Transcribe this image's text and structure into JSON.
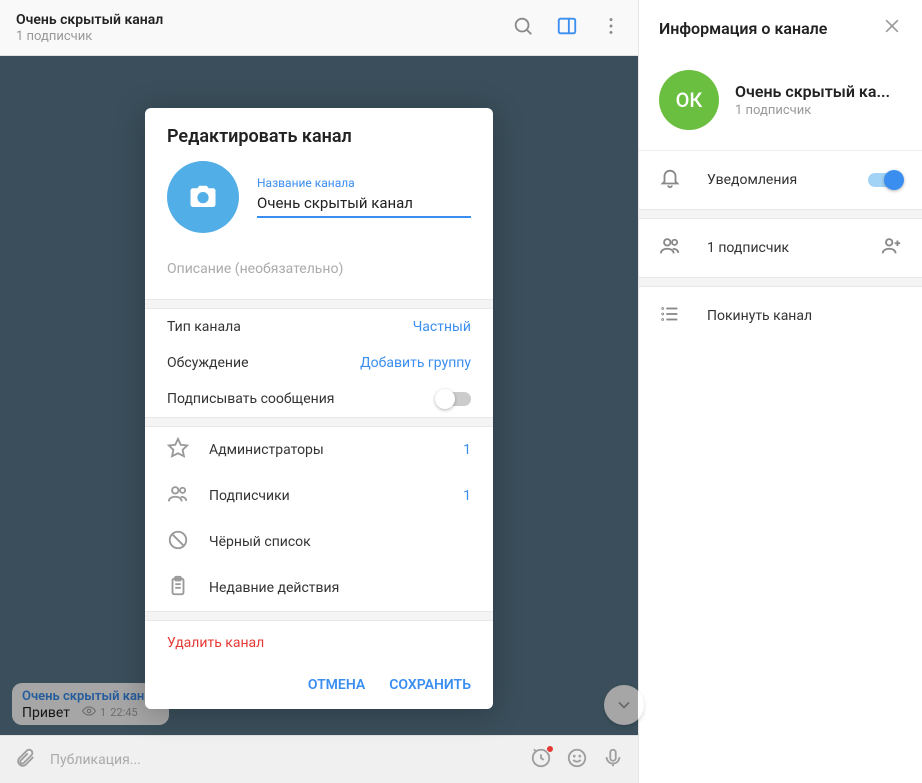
{
  "chat": {
    "title": "Очень скрытый канал",
    "subscribers": "1 подписчик",
    "composer_placeholder": "Публикация...",
    "message": {
      "author": "Очень скрытый канал",
      "text": "Привет",
      "views": "1",
      "time": "22:45"
    }
  },
  "modal": {
    "title": "Редактировать канал",
    "name_label": "Название канала",
    "name_value": "Очень скрытый канал",
    "desc_placeholder": "Описание (необязательно)",
    "type_label": "Тип канала",
    "type_value": "Частный",
    "discussion_label": "Обсуждение",
    "discussion_value": "Добавить группу",
    "sign_label": "Подписывать сообщения",
    "admins_label": "Администраторы",
    "admins_count": "1",
    "subs_label": "Подписчики",
    "subs_count": "1",
    "blacklist_label": "Чёрный список",
    "recent_label": "Недавние действия",
    "delete_label": "Удалить канал",
    "cancel": "ОТМЕНА",
    "save": "СОХРАНИТЬ"
  },
  "sidebar": {
    "title": "Информация о канале",
    "avatar_initials": "ОК",
    "channel_name": "Очень скрытый ка...",
    "subscribers": "1 подписчик",
    "notifications_label": "Уведомления",
    "subs_label": "1 подписчик",
    "leave_label": "Покинуть канал"
  }
}
